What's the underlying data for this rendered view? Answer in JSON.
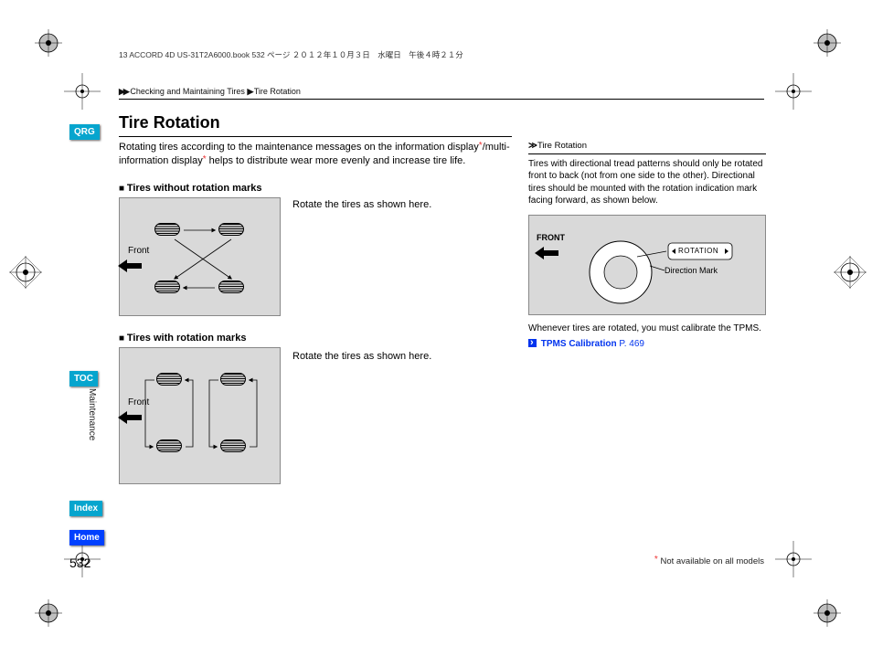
{
  "doc_header": "13 ACCORD 4D US-31T2A6000.book  532 ページ  ２０１２年１０月３日　水曜日　午後４時２１分",
  "breadcrumb": {
    "arrows": "▶▶",
    "seg1": "Checking and Maintaining Tires",
    "sep": "▶",
    "seg2": "Tire Rotation"
  },
  "sidebar": {
    "qrg": "QRG",
    "toc": "TOC",
    "index": "Index",
    "home": "Home",
    "section": "Maintenance"
  },
  "title": "Tire Rotation",
  "intro_a": "Rotating tires according to the maintenance messages on the information display",
  "intro_b": "/multi-information display",
  "intro_c": " helps to distribute wear more evenly and increase tire life.",
  "sec1_head": "Tires without rotation marks",
  "sec1_caption": "Rotate the tires as shown here.",
  "sec2_head": "Tires with rotation marks",
  "sec2_caption": "Rotate the tires as shown here.",
  "diagram": {
    "front": "Front"
  },
  "callout": {
    "head_prefix": "≫",
    "head": "Tire Rotation",
    "body": "Tires with directional tread patterns should only be rotated front to back (not from one side to the other). Directional tires should be mounted with the rotation indication mark facing forward, as shown below.",
    "tire_front": "FRONT",
    "tire_rot": "ROTATION",
    "tire_dir": "Direction Mark",
    "tpms_note": "Whenever tires are rotated, you must calibrate the TPMS.",
    "tpms_link": "TPMS Calibration",
    "tpms_page": "P. 469"
  },
  "page_number": "532",
  "footnote_star": "*",
  "footnote": " Not available on all models"
}
